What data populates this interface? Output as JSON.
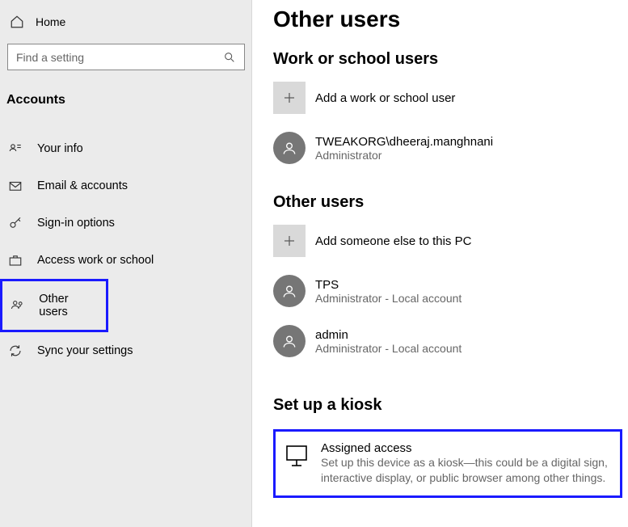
{
  "sidebar": {
    "home": "Home",
    "search_placeholder": "Find a setting",
    "section": "Accounts",
    "items": [
      {
        "label": "Your info"
      },
      {
        "label": "Email & accounts"
      },
      {
        "label": "Sign-in options"
      },
      {
        "label": "Access work or school"
      },
      {
        "label": "Other users"
      },
      {
        "label": "Sync your settings"
      }
    ]
  },
  "main": {
    "title": "Other users",
    "work_school": {
      "heading": "Work or school users",
      "add_label": "Add a work or school user",
      "users": [
        {
          "name": "TWEAKORG\\dheeraj.manghnani",
          "role": "Administrator"
        }
      ]
    },
    "other": {
      "heading": "Other users",
      "add_label": "Add someone else to this PC",
      "users": [
        {
          "name": "TPS",
          "role": "Administrator - Local account"
        },
        {
          "name": "admin",
          "role": "Administrator - Local account"
        }
      ]
    },
    "kiosk": {
      "heading": "Set up a kiosk",
      "title": "Assigned access",
      "desc": "Set up this device as a kiosk—this could be a digital sign, interactive display, or public browser among other things."
    }
  }
}
